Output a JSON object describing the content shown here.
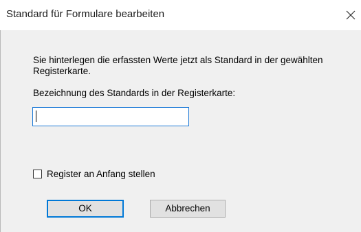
{
  "window": {
    "title": "Standard für Formulare bearbeiten",
    "close_icon": "close-icon"
  },
  "dialog": {
    "description": "Sie hinterlegen die erfassten Werte jetzt als Standard in der gewählten Registerkarte.",
    "field_label": "Bezeichnung des Standards in der Registerkarte:",
    "name_value": "",
    "checkbox_label": "Register an Anfang stellen",
    "checkbox_checked": false,
    "ok_label": "OK",
    "cancel_label": "Abbrechen"
  },
  "colors": {
    "focus_accent": "#0078d7",
    "background": "#f0f0f0"
  }
}
